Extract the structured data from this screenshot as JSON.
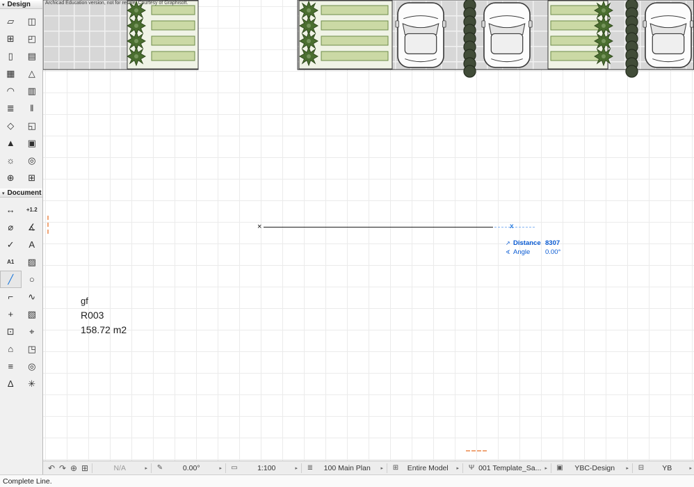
{
  "app": {
    "education_banner": "Archicad Education version, not for resale. Courtesy of Graphisoft.",
    "status_text": "Complete Line."
  },
  "colors": {
    "accent_blue": "#0d6fd8",
    "tracker_blue": "#0a5bd3",
    "ghost_dash_blue": "#85b4f2",
    "trace_orange": "#f0a577",
    "planter_green": "#cbd9a5",
    "tree_green": "#4a6e2f",
    "paving_gray": "#d7d7d7"
  },
  "toolbox": {
    "design": {
      "label": "Design",
      "collapse_icon": "▾",
      "tools": [
        {
          "name": "wall-tool",
          "glyph": "▱"
        },
        {
          "name": "door-tool",
          "glyph": "◫"
        },
        {
          "name": "window-tool",
          "glyph": "⊞"
        },
        {
          "name": "corner-window-tool",
          "glyph": "◰"
        },
        {
          "name": "column-tool",
          "glyph": "▯"
        },
        {
          "name": "beam-tool",
          "glyph": "▤"
        },
        {
          "name": "slab-tool",
          "glyph": "▦"
        },
        {
          "name": "roof-tool",
          "glyph": "△"
        },
        {
          "name": "shell-tool",
          "glyph": "◠"
        },
        {
          "name": "curtain-wall-tool",
          "glyph": "▥"
        },
        {
          "name": "stair-tool",
          "glyph": "≣"
        },
        {
          "name": "railing-tool",
          "glyph": "‖"
        },
        {
          "name": "morph-tool",
          "glyph": "◇"
        },
        {
          "name": "zone-tool",
          "glyph": "◱"
        },
        {
          "name": "mesh-tool",
          "glyph": "▲"
        },
        {
          "name": "object-tool",
          "glyph": "▣"
        },
        {
          "name": "lamp-tool",
          "glyph": "☼"
        },
        {
          "name": "opening-tool",
          "glyph": "◎"
        },
        {
          "name": "hotlink-tool",
          "glyph": "⊕"
        },
        {
          "name": "grid-tool",
          "glyph": "⊞"
        }
      ]
    },
    "document": {
      "label": "Document",
      "collapse_icon": "▾",
      "tools": [
        {
          "name": "dimension-tool",
          "glyph": "↔"
        },
        {
          "name": "level-dimension-tool",
          "glyph": "+1.2"
        },
        {
          "name": "radial-dimension-tool",
          "glyph": "⌀"
        },
        {
          "name": "angle-dimension-tool",
          "glyph": "∡"
        },
        {
          "name": "elevation-dimension-tool",
          "glyph": "✓"
        },
        {
          "name": "text-tool",
          "glyph": "A"
        },
        {
          "name": "label-tool",
          "glyph": "A1"
        },
        {
          "name": "fill-tool",
          "glyph": "▨"
        },
        {
          "name": "line-tool",
          "glyph": "╱",
          "selected": true
        },
        {
          "name": "circle-tool",
          "glyph": "○"
        },
        {
          "name": "polyline-tool",
          "glyph": "⌐"
        },
        {
          "name": "spline-tool",
          "glyph": "∿"
        },
        {
          "name": "hotspot-tool",
          "glyph": "+"
        },
        {
          "name": "figure-tool",
          "glyph": "▧"
        },
        {
          "name": "drawing-tool",
          "glyph": "⊡"
        },
        {
          "name": "section-tool",
          "glyph": "⌖"
        },
        {
          "name": "elevation-tool",
          "glyph": "⌂"
        },
        {
          "name": "interior-elevation-tool",
          "glyph": "◳"
        },
        {
          "name": "worksheet-tool",
          "glyph": "≡"
        },
        {
          "name": "detail-tool",
          "glyph": "◎"
        },
        {
          "name": "change-tool",
          "glyph": "Δ"
        },
        {
          "name": "camera-tool",
          "glyph": "✳"
        }
      ]
    }
  },
  "canvas": {
    "zone_label": {
      "name": "gf",
      "number": "R003",
      "area": "158.72 m2"
    },
    "start_marker": "×",
    "end_marker": "x",
    "tracker": {
      "distance_icon": "↗",
      "distance_label": "Distance",
      "distance_value": "8307",
      "angle_icon": "∢",
      "angle_label": "Angle",
      "angle_value": "0.00°"
    }
  },
  "bottom_bar": {
    "arrow_glyph": "▸",
    "icons": [
      {
        "name": "zoom-undo-icon",
        "glyph": "↶"
      },
      {
        "name": "zoom-redo-icon",
        "glyph": "↷"
      },
      {
        "name": "zoom-in-icon",
        "glyph": "⊕"
      },
      {
        "name": "fit-in-window-icon",
        "glyph": "⊞"
      }
    ],
    "groups": [
      {
        "name": "pen-set-selector",
        "value": "N/A",
        "muted": true
      },
      {
        "name": "orientation-selector",
        "value": "0.00°",
        "icon": "✎"
      },
      {
        "name": "scale-selector",
        "value": "1:100",
        "icon": "▭"
      },
      {
        "name": "story-selector",
        "value": "100 Main Plan",
        "icon": "≣"
      },
      {
        "name": "model-filter-selector",
        "value": "Entire Model",
        "icon": "⊞"
      },
      {
        "name": "template-selector",
        "value": "001 Template_Sa...",
        "icon": "Ψ"
      },
      {
        "name": "profile-selector",
        "value": "YBC-Design",
        "icon": "▣"
      },
      {
        "name": "overflow-selector",
        "value": "YB",
        "icon": "⊟"
      }
    ]
  }
}
